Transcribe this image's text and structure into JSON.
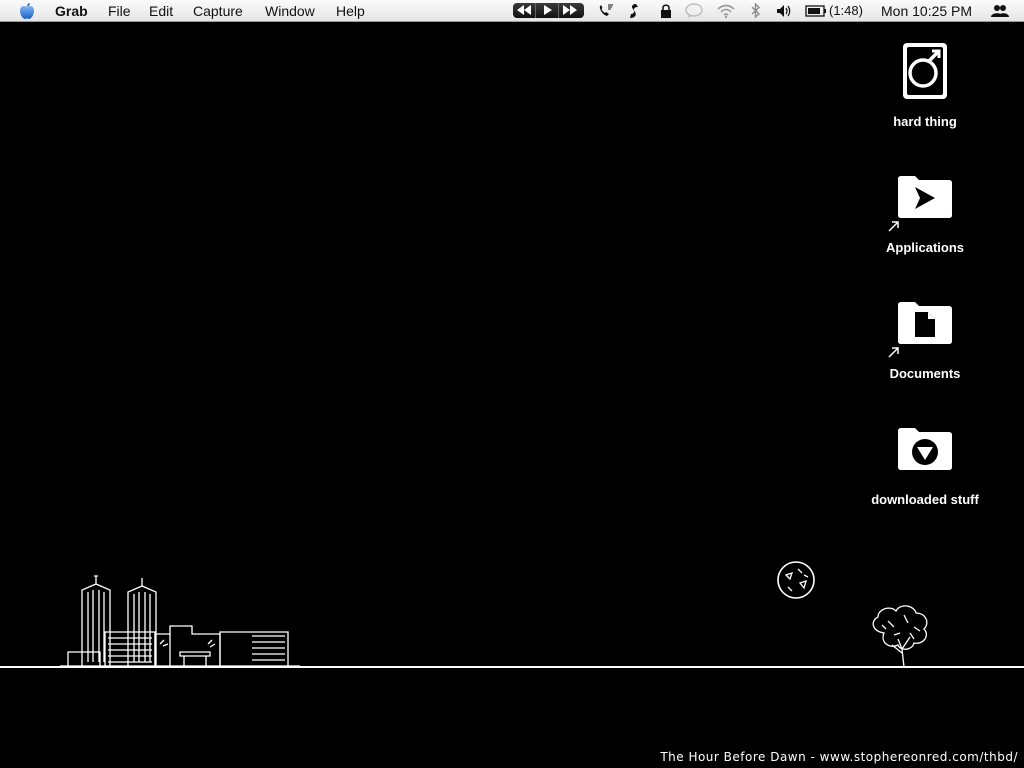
{
  "menubar": {
    "app_name": "Grab",
    "menus": [
      "File",
      "Edit",
      "Capture",
      "Window",
      "Help"
    ],
    "battery_time": "(1:48)",
    "clock": "Mon 10:25 PM",
    "status_icons": [
      "phone-icon",
      "script-icon",
      "lock-icon",
      "chat-bubble-icon",
      "wifi-icon",
      "bluetooth-icon",
      "volume-icon",
      "battery-icon",
      "users-icon"
    ]
  },
  "desktop": {
    "icons": [
      {
        "label": "hard thing",
        "icon": "hard-drive-icon"
      },
      {
        "label": "Applications",
        "icon": "applications-folder-icon",
        "alias": true
      },
      {
        "label": "Documents",
        "icon": "documents-folder-icon",
        "alias": true
      },
      {
        "label": "downloaded stuff",
        "icon": "downloads-folder-icon"
      }
    ]
  },
  "wallpaper": {
    "credit": "The Hour Before Dawn - www.stophereonred.com/thbd/",
    "line_color": "#ffffff",
    "background_color": "#000000"
  }
}
